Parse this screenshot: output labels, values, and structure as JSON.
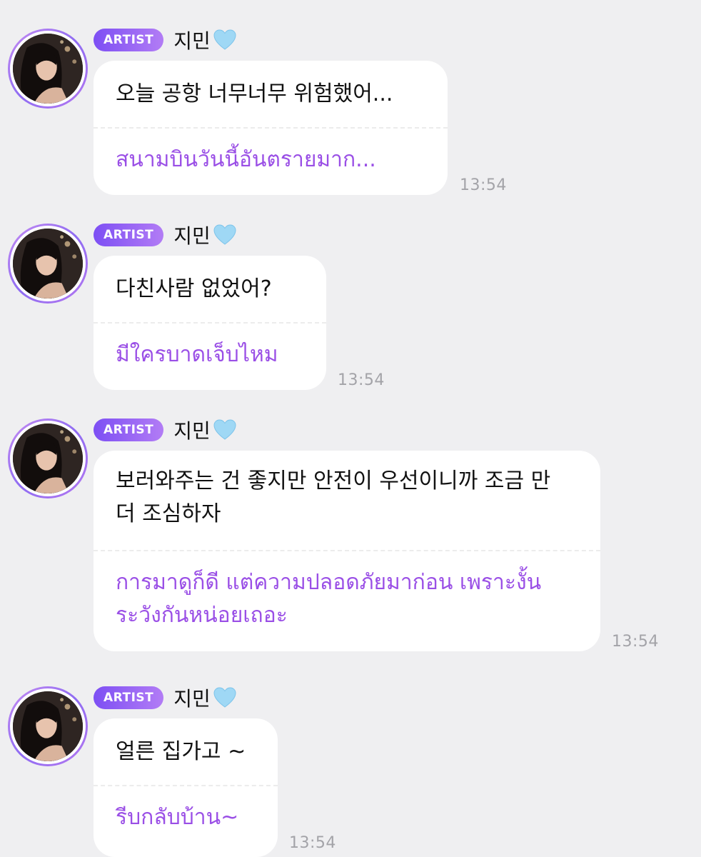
{
  "messages": [
    {
      "badge": "ARTIST",
      "name": "지민",
      "korean": "오늘 공항 너무너무 위험했어...",
      "thai": "สนามบินวันนี้อันตรายมาก...",
      "time": "13:54"
    },
    {
      "badge": "ARTIST",
      "name": "지민",
      "korean": "다친사람 없었어?",
      "thai": "มีใครบาดเจ็บไหม",
      "time": "13:54"
    },
    {
      "badge": "ARTIST",
      "name": "지민",
      "korean": "보러와주는 건 좋지만 안전이 우선이니까 조금 만 더 조심하자",
      "thai": "การมาดูก็ดี แต่ความปลอดภัยมาก่อน เพราะงั้นระวังกันหน่อยเถอะ",
      "time": "13:54"
    },
    {
      "badge": "ARTIST",
      "name": "지민",
      "korean": "얼른 집가고 ~",
      "thai": "รีบกลับบ้าน~",
      "time": "13:54"
    }
  ],
  "colors": {
    "background": "#efeff1",
    "badge_start": "#7d4ff4",
    "badge_end": "#b27cf5",
    "translation_text": "#9a4fe6",
    "timestamp": "#a3a3a8",
    "heart": "#9fd8f5"
  },
  "icons": {
    "heart": "light-blue-heart-icon",
    "avatar": "profile-photo"
  }
}
